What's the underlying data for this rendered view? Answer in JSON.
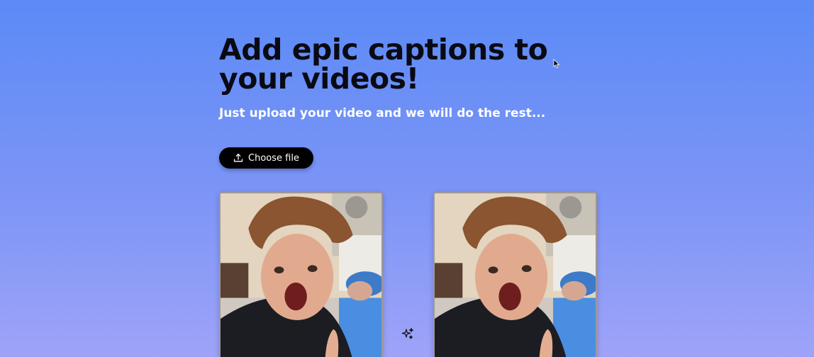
{
  "hero": {
    "title": "Add epic captions to your videos!",
    "subtitle": "Just upload your video and we will do the rest..."
  },
  "upload": {
    "label": "Choose file",
    "icon": "upload-icon"
  },
  "videos": {
    "before": "video-thumbnail",
    "after": "video-thumbnail"
  },
  "icons": {
    "sparkle": "sparkles-icon",
    "cursor": "mouse-cursor"
  },
  "colors": {
    "background_top": "#5b8af6",
    "background_bottom": "#9ea3f8",
    "title": "#0a0a14",
    "subtitle": "#ffffff",
    "button": "#000000"
  }
}
